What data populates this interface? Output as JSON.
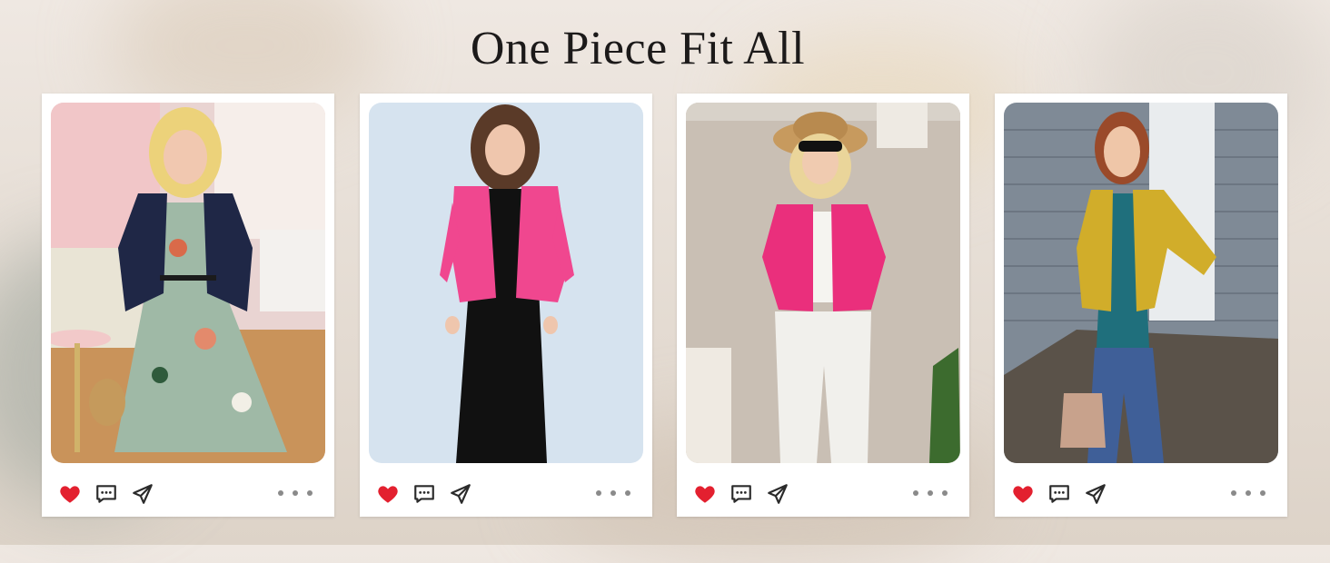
{
  "page": {
    "title": "One Piece Fit All"
  },
  "theme": {
    "heart_color": "#e3202f",
    "icon_color": "#2b2b2b",
    "card_bg": "#ffffff"
  },
  "cards": [
    {
      "photo": "woman-navy-cardigan-floral-dress",
      "cardigan_color": "#1f2746",
      "icons": [
        "heart-icon",
        "comment-icon",
        "share-icon",
        "more-icon"
      ]
    },
    {
      "photo": "woman-pink-cardigan-black-dress",
      "cardigan_color": "#f0478f",
      "icons": [
        "heart-icon",
        "comment-icon",
        "share-icon",
        "more-icon"
      ]
    },
    {
      "photo": "woman-pink-cardigan-white-jeans",
      "cardigan_color": "#ea2f7c",
      "icons": [
        "heart-icon",
        "comment-icon",
        "share-icon",
        "more-icon"
      ]
    },
    {
      "photo": "woman-yellow-cardigan-teal-top",
      "cardigan_color": "#d1ad2a",
      "icons": [
        "heart-icon",
        "comment-icon",
        "share-icon",
        "more-icon"
      ]
    }
  ]
}
